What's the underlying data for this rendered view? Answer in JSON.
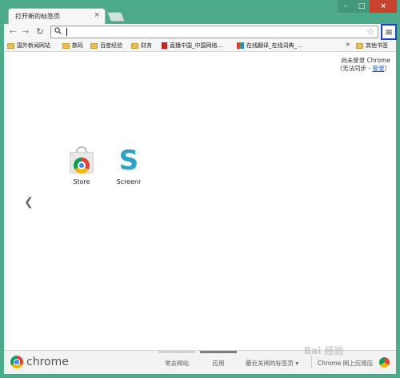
{
  "window": {
    "tab_title": "打开新的标签页",
    "close_tab_glyph": "×",
    "minimize_glyph": "–",
    "maximize_glyph": "□",
    "close_glyph": "×"
  },
  "toolbar": {
    "back_glyph": "←",
    "forward_glyph": "→",
    "reload_glyph": "↻",
    "omnibox_value": "",
    "omnibox_icon": "search-icon",
    "star_glyph": "☆",
    "menu_glyph": "≡",
    "menu_highlight_color": "#1d3fd6"
  },
  "bookmarks": {
    "items": [
      {
        "label": "国外新闻网站",
        "icon": "folder-icon"
      },
      {
        "label": "数码",
        "icon": "folder-icon"
      },
      {
        "label": "百度经验",
        "icon": "folder-icon"
      },
      {
        "label": "财务",
        "icon": "folder-icon"
      },
      {
        "label": "直播中国_中国网络...",
        "icon": "page-icon"
      },
      {
        "label": "在线翻译_在线词典_...",
        "icon": "page-icon"
      }
    ],
    "overflow_glyph": "»",
    "other_label": "其他书签"
  },
  "content": {
    "signin_line1": "尚未登录 Chrome",
    "signin_prefix": "（无法同步 - ",
    "signin_link": "登录",
    "signin_suffix": "）",
    "apps": [
      {
        "label": "Store",
        "icon": "chrome-web-store-icon"
      },
      {
        "label": "Screenr",
        "icon": "screenr-icon"
      }
    ],
    "prev_glyph": "❮"
  },
  "footer": {
    "brand": "chrome",
    "tabs": [
      {
        "label": "常去网站",
        "active": false
      },
      {
        "label": "应用",
        "active": true
      }
    ],
    "recently_closed": "最近关闭的标签页 ▾",
    "web_store": "Chrome 网上应用店"
  },
  "watermark": "Bai 经验"
}
